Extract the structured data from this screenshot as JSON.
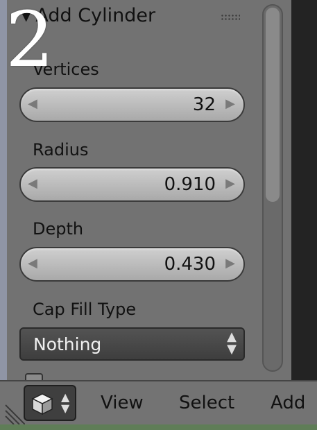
{
  "panel": {
    "title": "Add Cylinder",
    "collapse_icon": "triangle-down-icon",
    "grip_icon": "drag-grip-icon"
  },
  "overlay_number": "2",
  "fields": {
    "vertices": {
      "label": "Vertices",
      "value": "32"
    },
    "radius": {
      "label": "Radius",
      "value": "0.910"
    },
    "depth": {
      "label": "Depth",
      "value": "0.430"
    },
    "cap_fill_type": {
      "label": "Cap Fill Type",
      "value": "Nothing"
    }
  },
  "header": {
    "mode_icon": "cube-icon",
    "menus": [
      "View",
      "Select",
      "Add"
    ]
  }
}
